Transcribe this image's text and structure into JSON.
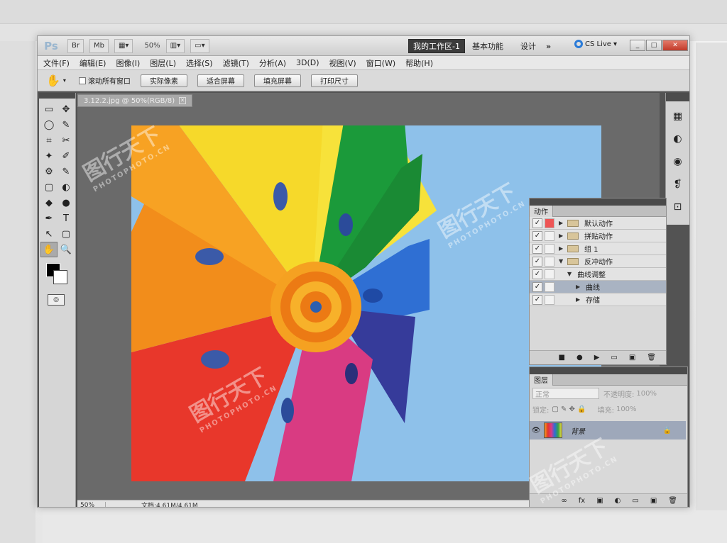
{
  "app": {
    "logo": "Ps",
    "zoom": "50%",
    "workspaces": [
      "我的工作区-1",
      "基本功能",
      "设计",
      "»"
    ],
    "cs_live": "CS Live",
    "window_buttons": [
      "_",
      "□",
      "✕"
    ]
  },
  "menu": [
    "文件(F)",
    "编辑(E)",
    "图像(I)",
    "图层(L)",
    "选择(S)",
    "滤镜(T)",
    "分析(A)",
    "3D(D)",
    "视图(V)",
    "窗口(W)",
    "帮助(H)"
  ],
  "options": {
    "scroll_all_label": "滚动所有窗口",
    "buttons": [
      "实际像素",
      "适合屏幕",
      "填充屏幕",
      "打印尺寸"
    ]
  },
  "document": {
    "tab_title": "3.12.2.jpg @ 50%(RGB/8)",
    "close": "✕",
    "status_zoom": "50%",
    "status_doc": "文档:4.61M/4.61M"
  },
  "tools": [
    "▭",
    "✥",
    "◯",
    "✎",
    "⌗",
    "✂",
    "✦",
    "✐",
    "⚙",
    "✎",
    "▢",
    "◐",
    "◆",
    "●",
    "✒",
    "T",
    "↖",
    "▢",
    "✋",
    "🔍"
  ],
  "actions_panel": {
    "tab": "动作",
    "items": [
      {
        "label": "默认动作",
        "level": 0,
        "red": true,
        "folder": true
      },
      {
        "label": "拼贴动作",
        "level": 0,
        "folder": true
      },
      {
        "label": "组 1",
        "level": 0,
        "folder": true
      },
      {
        "label": "反冲动作",
        "level": 0,
        "folder": true,
        "open": true
      },
      {
        "label": "曲线调整",
        "level": 1,
        "open": true
      },
      {
        "label": "曲线",
        "level": 2,
        "selected": true
      },
      {
        "label": "存储",
        "level": 2
      }
    ],
    "footer": [
      "■",
      "●",
      "▶",
      "▭",
      "▣",
      "🗑"
    ]
  },
  "layers_panel": {
    "tab": "图层",
    "blend_mode": "正常",
    "opacity_label": "不透明度:",
    "opacity": "100%",
    "lock_label": "锁定:",
    "fill_label": "填充:",
    "fill": "100%",
    "layer_name": "背景",
    "lock_icon": "🔒",
    "eye": "👁",
    "footer": [
      "∞",
      "fx",
      "▣",
      "◐",
      "▭",
      "▣",
      "🗑"
    ]
  },
  "watermark": {
    "cn": "图行天下",
    "en": "PHOTOPHOTO.CN"
  }
}
